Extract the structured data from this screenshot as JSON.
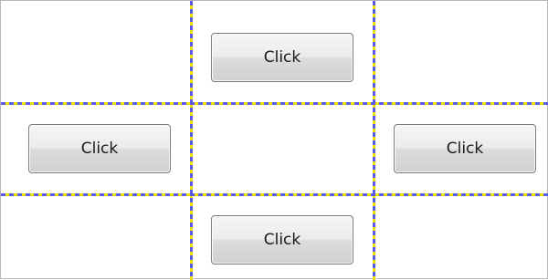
{
  "buttons": {
    "top": {
      "label": "Click"
    },
    "left": {
      "label": "Click"
    },
    "right": {
      "label": "Click"
    },
    "bottom": {
      "label": "Click"
    }
  },
  "colors": {
    "grid_dash": "#5b5bf0",
    "grid_gap": "#f4e000",
    "button_border": "#7a7a7a"
  }
}
